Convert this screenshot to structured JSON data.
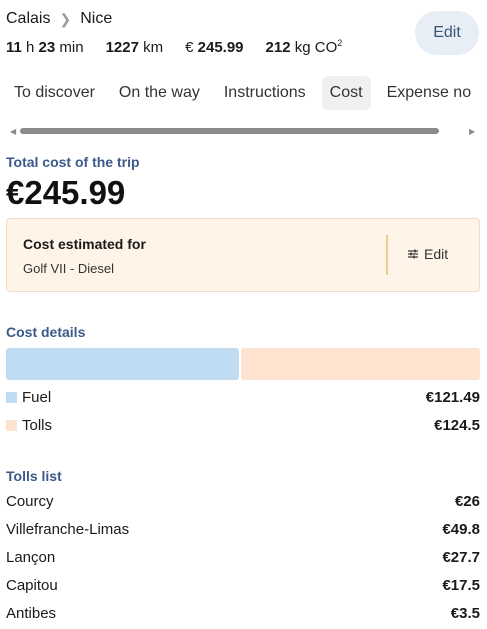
{
  "route": {
    "from": "Calais",
    "to": "Nice"
  },
  "stats": {
    "hours": "11",
    "hours_unit": "h",
    "minutes": "23",
    "minutes_unit": "min",
    "distance": "1227",
    "distance_unit": "km",
    "price_currency": "€",
    "price_value": "245.99",
    "co2_value": "212",
    "co2_unit": "kg CO",
    "co2_sup": "2"
  },
  "header": {
    "edit_label": "Edit"
  },
  "tabs": [
    {
      "label": "To discover",
      "active": false
    },
    {
      "label": "On the way",
      "active": false
    },
    {
      "label": "Instructions",
      "active": false
    },
    {
      "label": "Cost",
      "active": true
    },
    {
      "label": "Expense no",
      "active": false
    }
  ],
  "cost": {
    "total_label": "Total cost of the trip",
    "total_value": "€245.99",
    "estimate": {
      "title": "Cost estimated for",
      "vehicle": "Golf VII - Diesel",
      "edit_label": "Edit"
    },
    "details_label": "Cost details",
    "breakdown": [
      {
        "label": "Fuel",
        "value": "€121.49",
        "amount": 121.49,
        "color": "#bfdcf3"
      },
      {
        "label": "Tolls",
        "value": "€124.5",
        "amount": 124.5,
        "color": "#fde3d0"
      }
    ],
    "tolls_label": "Tolls list",
    "tolls": [
      {
        "name": "Courcy",
        "value": "€26"
      },
      {
        "name": "Villefranche-Limas",
        "value": "€49.8"
      },
      {
        "name": "Lançon",
        "value": "€27.7"
      },
      {
        "name": "Capitou",
        "value": "€17.5"
      },
      {
        "name": "Antibes",
        "value": "€3.5"
      }
    ]
  }
}
